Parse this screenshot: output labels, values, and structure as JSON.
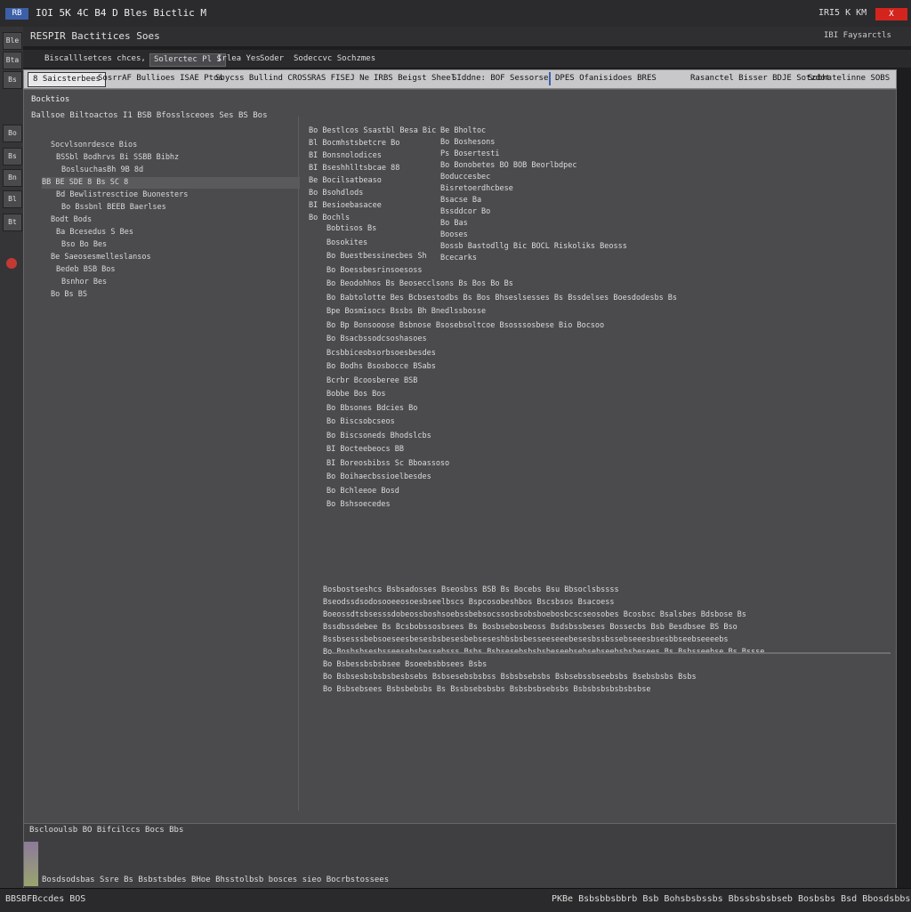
{
  "titlebar": {
    "logo": "RB",
    "title": "IOI 5K 4C B4 D Bles Bictlic M",
    "right_text": "IRI5 K KM",
    "close_label": "X"
  },
  "header": {
    "title": "RESPIR Bactitices Soes",
    "right_text": "IBI  Faysarctls"
  },
  "menubar": {
    "items": [
      "Biscalllsetces chces, Soioces",
      "Solerctec Pl S",
      "Irlea Yes",
      "Soder",
      "Sodeccvc Sochzmes"
    ],
    "active_index": 1
  },
  "tabbar": {
    "items": [
      "8  Saicsterbees",
      "SosrrAF Bullioes ISAE Ptos",
      "Sbycss Bullind CROSS",
      "RAS FISEJ Ne",
      "IRBS Beigst Sheel",
      "SIddne: BOF Sessorse",
      "DPES Ofanisidoes BRES",
      "Rasanctel Bisser BDJE Sotzdot",
      "Sobhatelinne SOBS"
    ],
    "selected_index": 0
  },
  "left_panel": {
    "title": "Bocktios",
    "header": "Ballsoe Biltoactos  I1  BSB Bfosslsceoes  Ses  BS Bos",
    "rows": [
      "Socvlsonrdesce Bios",
      "BSSbl  Bodhrvs Bi SSBB Bibhz",
      "BoslsuchasBh 9B 8d",
      "BB BE SDE 8 Bs SC 8",
      "Bd  Bewlistresctioe Buonesters",
      "Bo  Bssbnl BEEB Baerlses",
      "Bodt Bods",
      "Ba Bcesedus S Bes",
      "Bso Bo Bes",
      "Be  Saeosesmelleslansos",
      "Bedeb BSB Bos",
      "Bsnhor Bes",
      "Bo  Bs BS"
    ],
    "selected_index": 3
  },
  "center_col": {
    "rows": [
      "Bo  Bestlcos Ssastbl  Besa Bic",
      "Bl  Bocmhstsbetcre Bo",
      "BI  Bonsnolodices",
      "BI  Bseshhlltsbcae 88",
      "Be  Bocilsatbeaso",
      "Bo  Bsohdlods",
      "BI  Besioebasacee",
      "Bo  Bochls"
    ]
  },
  "right_col": {
    "rows": [
      "Be Bholtoc",
      "Bo Boshesons",
      "Ps Bosertesti",
      "Bo Bonobetes BO BOB  Beorlbdpec",
      "Boduccesbec",
      "Bisretoerdhcbese",
      "Bsacse Ba",
      "Bssddcor Bo",
      "Bo Bas",
      "Booses",
      "Bossb Bastodllg Bic BOCL  Riskoliks Beosss",
      "Bcecarks"
    ]
  },
  "main_rows": [
    {
      "text": "Bobtisos Bs",
      "red": true
    },
    {
      "text": "Bosokites",
      "red": false
    },
    {
      "text": "Bo  Buestbessinecbes Sh",
      "red": false
    },
    {
      "text": "Bo Boessbesrinsoesoss",
      "red": true
    },
    {
      "text": "Bo Beodohhos  Bs     Beosecclsons  Bs Bos  Bo  Bs",
      "red": false
    },
    {
      "text": "Bo Babtolotte Bes  Bcbsestodbs  Bs  Bos Bhseslsesses Bs  Bssdelses Boesdodesbs Bs",
      "red": false
    },
    {
      "text": "Bpe Bosmisocs  Bssbs Bh Bnedlssbosse",
      "red": false
    },
    {
      "text": "Bo  Bp Bonsooose Bsbnose  Bsosebsoltcoe Bsosssosbese  Bio Bocsoo",
      "red": false
    },
    {
      "text": "Bo  Bsacbssodcsoshasoes",
      "red": true
    },
    {
      "text": "Bcsbbiceobsorbsoesbesdes",
      "red": false
    },
    {
      "text": "Bo  Bodhs  Bsosbocce BSabs",
      "red": false
    },
    {
      "text": "Bcrbr  Bcoosberee BSB",
      "red": true
    },
    {
      "text": "Bobbe  Bos Bos",
      "red": false
    },
    {
      "text": "Bo  Bbsones Bdcies Bo",
      "red": false
    },
    {
      "text": "Bo Biscsobcseos",
      "red": false
    },
    {
      "text": "Bo Biscsoneds  Bhodslcbs",
      "red": true
    },
    {
      "text": "BI Bocteebeocs BB",
      "red": false
    },
    {
      "text": "BI  Boreosbibss Sc Bboassoso",
      "red": false
    },
    {
      "text": "Bo  Boihaecbssioelbesdes",
      "red": false
    },
    {
      "text": "Bo  Bchleeoe Bosd",
      "red": false
    },
    {
      "text": "Bo  Bshsoecedes",
      "red": false
    }
  ],
  "long_rows": [
    "Bosbostseshcs  Bsbsadosses Bseosbss BSB Bs  Bocebs  Bsu Bbsoclsbssss",
    "Bseodssdsodosooeeosoesbseelbscs Bspcosobeshbos  Bscsbsos  Bsacoess",
    "Boeossdtsbsesssdobeossboshsoebssbebsocssosbsobsboebosbcscseosobes  Bcosbsc  Bsalsbes  Bdsbose  Bs",
    "Bssdbssdebee Bs Bcsbobssosbsees Bs Bosbsebosbeoss  Bsdsbssbeses  Bossecbs  Bsb Besdbsee  BS Bso",
    "Bssbsesssbebsoeseesbesesbsbesesbebseseshbsbsbesseeseeebesesbssbssebseeesbsesbbseebseeeebs",
    "Bo  Bosbsbsesbsseesebsbessebsss  Bsbs  Bsbsesebsbsbsbeseebsebsebseebsbsbesees  Bs Bsbsseebse  Bs  Bssse",
    "Bo  Bsbessbsbsbsee Bsoeebsbbsees  Bsbs",
    "Bo  Bsbsesbsbsbsbesbsebs Bsbsesebsbsbss  Bsbsbsebsbs  Bsbsebssbseebsbs  Bsebsbsbs  Bsbs",
    "Bo  Bsbsebsees  Bsbsbebsbs Bs  Bssbsebsbsbs  Bsbsbsbsebsbs  Bsbsbsbsbsbsbsbse"
  ],
  "bottom_panel": {
    "title": "Bsclooulsb BO  Bifcilccs    Bocs    Bbs",
    "line": "Bosdsodsbas  Ssre  Bs Bsbstsbdes BHoe Bhsstolbsb bosces sieo Bocrbstossees"
  },
  "status": {
    "left": "BBSBFBccdes  BOS",
    "right": "PKBe  Bsbsbbsbbrb  Bsb Bohsbsbssbs Bbssbsbsbseb  Bosbsbs  Bsd Bbosdsbbscsb"
  },
  "tools": [
    "Ble",
    "Bta",
    "Bs",
    "Bo",
    "Bs",
    "Bn",
    "Bl",
    "Bt"
  ]
}
